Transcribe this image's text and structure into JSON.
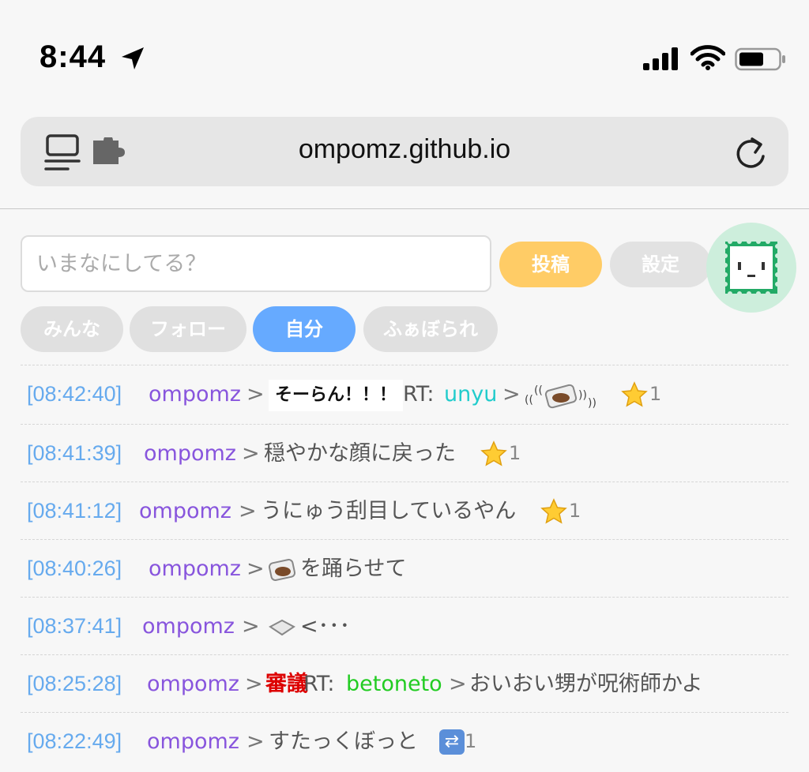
{
  "status_bar": {
    "time": "8:44"
  },
  "browser": {
    "url": "ompomz.github.io"
  },
  "compose": {
    "placeholder": "いまなにしてる？",
    "post_label": "投稿",
    "settings_label": "設定"
  },
  "tabs": [
    {
      "label": "みんな"
    },
    {
      "label": "フォロー"
    },
    {
      "label": "自分"
    },
    {
      "label": "ふぁぼられ"
    }
  ],
  "colors": {
    "timestamp": "#66aaee",
    "username": "#8855dd",
    "post_button": "#ffcc66",
    "active_tab": "#66aaff"
  },
  "timeline": [
    {
      "time": "[08:42:40]",
      "user": "ompomz",
      "sep": ">",
      "stamp": "そーらん！！！",
      "rt_prefix": "RT:",
      "rt_user": "unyu",
      "rt_sep": ">",
      "star_count": "1",
      "icons": [
        "text-stamp",
        "vibrating-food-box-icon",
        "star-icon"
      ]
    },
    {
      "time": "[08:41:39]",
      "user": "ompomz",
      "sep": ">",
      "text": "穏やかな顔に戻った",
      "star_count": "1",
      "icons": [
        "star-icon"
      ]
    },
    {
      "time": "[08:41:12]",
      "user": "ompomz",
      "sep": ">",
      "text": "うにゅう刮目しているやん",
      "star_count": "1",
      "icons": [
        "star-icon"
      ]
    },
    {
      "time": "[08:40:26]",
      "user": "ompomz",
      "sep": ">",
      "text": "を踊らせて",
      "icons": [
        "food-box-icon"
      ]
    },
    {
      "time": "[08:37:41]",
      "user": "ompomz",
      "sep": ">",
      "text": "<･･･",
      "icons": [
        "empty-box-icon"
      ]
    },
    {
      "time": "[08:25:28]",
      "user": "ompomz",
      "sep": ">",
      "stamp_text": "審議",
      "rt_prefix": "RT:",
      "rt_user": "betoneto",
      "rt_sep": ">",
      "text": "おいおい甥が呪術師かよ"
    },
    {
      "time": "[08:22:49]",
      "user": "ompomz",
      "sep": ">",
      "text": "すたっくぼっと",
      "rt_count": "1",
      "icons": [
        "repost-icon"
      ]
    }
  ]
}
